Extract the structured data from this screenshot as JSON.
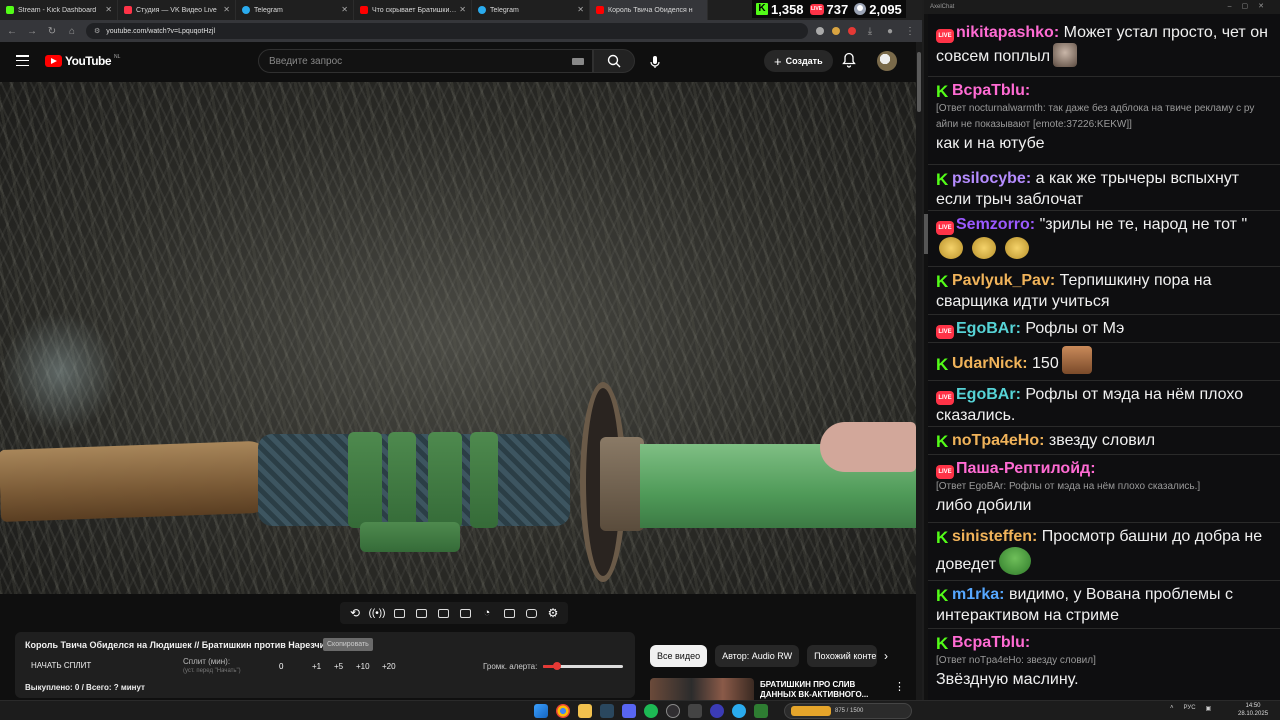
{
  "browser": {
    "tabs": [
      {
        "title": "Stream - Kick Dashboard",
        "favicon_color": "#53fc18",
        "active": false
      },
      {
        "title": "Студия — VK Видео Live",
        "favicon_color": "#ff3347",
        "active": false
      },
      {
        "title": "Telegram",
        "favicon_color": "#2aabee",
        "active": false
      },
      {
        "title": "Что скрывает Братишкин? Сп",
        "favicon_color": "#ff0000",
        "active": false
      },
      {
        "title": "Telegram",
        "favicon_color": "#2aabee",
        "active": false
      },
      {
        "title": "Король Твича Обиделся н",
        "favicon_color": "#ff0000",
        "active": true
      }
    ],
    "url": "youtube.com/watch?v=LpquqotHzjl"
  },
  "stats": {
    "kick": "1,358",
    "vk": "737",
    "twitch": "2,095",
    "vk_label": "LIVE"
  },
  "youtube": {
    "logo_text": "YouTube",
    "region": "NL",
    "search_placeholder": "Введите запрос",
    "create_label": "Создать",
    "plus": "+"
  },
  "split": {
    "title": "Король Твича Обиделся на Людишек // Братишкин против Нарезчиков",
    "badge": "Скопировать",
    "start_label": "НАЧАТЬ СПЛИТ",
    "minutes_label": "Сплит (мин):",
    "minutes_hint": "(уст. перед \"Начать\")",
    "minutes_value": "0",
    "increments": [
      "+1",
      "+5",
      "+10",
      "+20"
    ],
    "volume_label": "Громк. алерта:",
    "volume_level": 0.18,
    "bought": "Выкуплено: 0 / Всего: ? минут"
  },
  "recs": {
    "chips": [
      {
        "label": "Все видео",
        "active": true
      },
      {
        "label": "Автор: Audio RW",
        "active": false
      },
      {
        "label": "Похожий конте",
        "active": false
      }
    ],
    "next_icon": "›",
    "item_title": "БРАТИШКИН ПРО СЛИВ ДАННЫХ ВК-АКТИВНОГО...",
    "more_icon": "⋮"
  },
  "chat": {
    "window_title": "AxelChat",
    "vk_label": "LIVE",
    "kick_label": "K",
    "messages": [
      {
        "platform": "vk",
        "nick": "nikitapashko",
        "color": "#ff6bd3",
        "text": "Может устал просто, чет он совсем поплыл",
        "emote": "face"
      },
      {
        "platform": "kick",
        "nick": "BcpaTblu",
        "color": "#ff6bd3",
        "reply": "[Ответ nocturnalwarmth: так даже без адблока на твиче рекламу с ру айпи не показывают [emote:37226:KEKW]]",
        "text": "как и на ютубе"
      },
      {
        "platform": "kick",
        "nick": "psilocybe",
        "color": "#b58cff",
        "text": "а как же трычеры вспыхнут если трыч заблочат"
      },
      {
        "platform": "vk",
        "nick": "Semzorro",
        "color": "#9b59ff",
        "text": "\"зрилы не те, народ не тот \"",
        "emote": "cats"
      },
      {
        "platform": "kick",
        "nick": "Pavlyuk_Pav",
        "color": "#f0b35a",
        "text": "Терпишкину пора на сварщика идти учиться"
      },
      {
        "platform": "vk",
        "nick": "EgoBAr",
        "color": "#56d3d6",
        "text": "Рофлы от Мэ"
      },
      {
        "platform": "kick",
        "nick": "UdarNick",
        "color": "#f0b35a",
        "text": "150",
        "emote": "face2"
      },
      {
        "platform": "vk",
        "nick": "EgoBAr",
        "color": "#56d3d6",
        "text": "Рофлы от мэда на нём плохо сказались."
      },
      {
        "platform": "kick",
        "nick": "noTpa4eHo",
        "color": "#f0b35a",
        "text": "звезду словил"
      },
      {
        "platform": "vk",
        "nick": "Паша-Рептилойд",
        "color": "#ff6bd3",
        "reply": "[Ответ EgoBAr: Рофлы от мэда на нём плохо сказались.]",
        "text": "либо добили"
      },
      {
        "platform": "kick",
        "nick": "sinisteffen",
        "color": "#f0b35a",
        "text": "Просмотр башни до добра не доведет",
        "emote": "pepe"
      },
      {
        "platform": "kick",
        "nick": "m1rka",
        "color": "#56a7ff",
        "text": "видимо, у Вована проблемы с интерактивом на стриме"
      },
      {
        "platform": "kick",
        "nick": "BcpaTblu",
        "color": "#ff6bd3",
        "reply": "[Ответ noTpa4eHo: звезду словил]",
        "text": "Звёздную маслину."
      }
    ]
  },
  "taskbar": {
    "pill_text": "875 / 1500",
    "lang": "РУС",
    "time": "14:50",
    "date": "28.10.2025"
  }
}
